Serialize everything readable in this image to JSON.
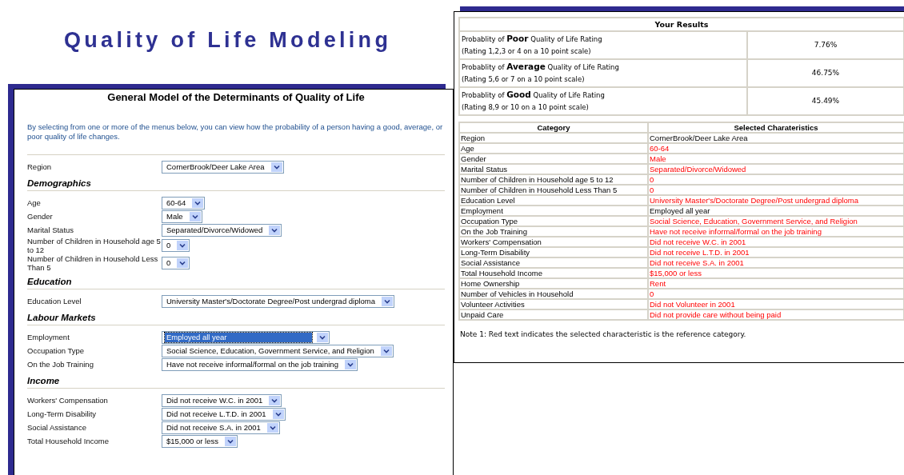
{
  "slide_title": "Quality of Life Modeling",
  "form": {
    "title": "General Model of the Determinants of Quality of Life",
    "intro": "By selecting from one or more of the menus below, you can view how the probability of a person having a good, average, or poor quality of life changes.",
    "sections": [
      {
        "fields": [
          {
            "label": "Region",
            "value": "CornerBrook/Deer Lake Area",
            "highlighted": false
          }
        ]
      },
      {
        "heading": "Demographics",
        "fields": [
          {
            "label": "Age",
            "value": "60-64",
            "highlighted": false
          },
          {
            "label": "Gender",
            "value": "Male",
            "highlighted": false
          },
          {
            "label": "Marital Status",
            "value": "Separated/Divorce/Widowed",
            "highlighted": false
          },
          {
            "label": "Number of Children in Household age 5 to 12",
            "value": "0",
            "highlighted": false
          },
          {
            "label": "Number of Children in Household Less Than 5",
            "value": "0",
            "highlighted": false
          }
        ]
      },
      {
        "heading": "Education",
        "fields": [
          {
            "label": "Education Level",
            "value": "University Master's/Doctorate Degree/Post undergrad diploma",
            "highlighted": false
          }
        ]
      },
      {
        "heading": "Labour Markets",
        "fields": [
          {
            "label": "Employment",
            "value": "Employed all year",
            "highlighted": true
          },
          {
            "label": "Occupation Type",
            "value": "Social Science, Education, Government Service, and Religion",
            "highlighted": false
          },
          {
            "label": "On the Job Training",
            "value": "Have not receive informal/formal on the job training",
            "highlighted": false
          }
        ]
      },
      {
        "heading": "Income",
        "fields": [
          {
            "label": "Workers' Compensation",
            "value": "Did not receive W.C. in 2001",
            "highlighted": false
          },
          {
            "label": "Long-Term Disability",
            "value": "Did not receive L.T.D. in 2001",
            "highlighted": false
          },
          {
            "label": "Social Assistance",
            "value": "Did not receive S.A. in 2001",
            "highlighted": false
          },
          {
            "label": "Total Household Income",
            "value": "$15,000 or less",
            "highlighted": false
          }
        ]
      }
    ]
  },
  "results": {
    "title": "Your Results",
    "rows": [
      {
        "line1": "Probablity of **Poor** Quality of Life Rating",
        "line2": "(Rating 1,2,3 or 4 on a 10 point scale)",
        "value": "7.76%"
      },
      {
        "line1": "Probablity of **Average** Quality of Life Rating",
        "line2": "(Rating 5,6 or 7 on a 10 point scale)",
        "value": "46.75%"
      },
      {
        "line1": "Probablity of **Good** Quality of Life Rating",
        "line2": "(Rating 8,9 or 10 on a 10 point scale)",
        "value": "45.49%"
      }
    ]
  },
  "characteristics": {
    "columns": [
      "Category",
      "Selected Charateristics"
    ],
    "rows": [
      {
        "category": "Region",
        "value": "CornerBrook/Deer Lake Area",
        "reference": false
      },
      {
        "category": "Age",
        "value": "60-64",
        "reference": true
      },
      {
        "category": "Gender",
        "value": "Male",
        "reference": true
      },
      {
        "category": "Marital Status",
        "value": "Separated/Divorce/Widowed",
        "reference": true
      },
      {
        "category": "Number of Children in Household age 5 to 12",
        "value": "0",
        "reference": true
      },
      {
        "category": "Number of Children in Household Less Than 5",
        "value": "0",
        "reference": true
      },
      {
        "category": "Education Level",
        "value": "University Master's/Doctorate Degree/Post undergrad diploma",
        "reference": true
      },
      {
        "category": "Employment",
        "value": "Employed all year",
        "reference": false
      },
      {
        "category": "Occupation Type",
        "value": "Social Science, Education, Government Service, and Religion",
        "reference": true
      },
      {
        "category": "On the Job Training",
        "value": "Have not receive informal/formal on the job training",
        "reference": true
      },
      {
        "category": "Workers' Compensation",
        "value": "Did not receive W.C. in 2001",
        "reference": true
      },
      {
        "category": "Long-Term Disability",
        "value": "Did not receive L.T.D. in 2001",
        "reference": true
      },
      {
        "category": "Social Assistance",
        "value": "Did not receive S.A. in 2001",
        "reference": true
      },
      {
        "category": "Total Household Income",
        "value": "$15,000 or less",
        "reference": true
      },
      {
        "category": "Home Ownership",
        "value": "Rent",
        "reference": true
      },
      {
        "category": "Number of Vehicles in Household",
        "value": "0",
        "reference": true
      },
      {
        "category": "Volunteer Activities",
        "value": "Did not Volunteer in 2001",
        "reference": true
      },
      {
        "category": "Unpaid Care",
        "value": "Did not provide care without being paid",
        "reference": true
      }
    ]
  },
  "note": "Note 1: Red text indicates the selected characteristic is the reference category."
}
